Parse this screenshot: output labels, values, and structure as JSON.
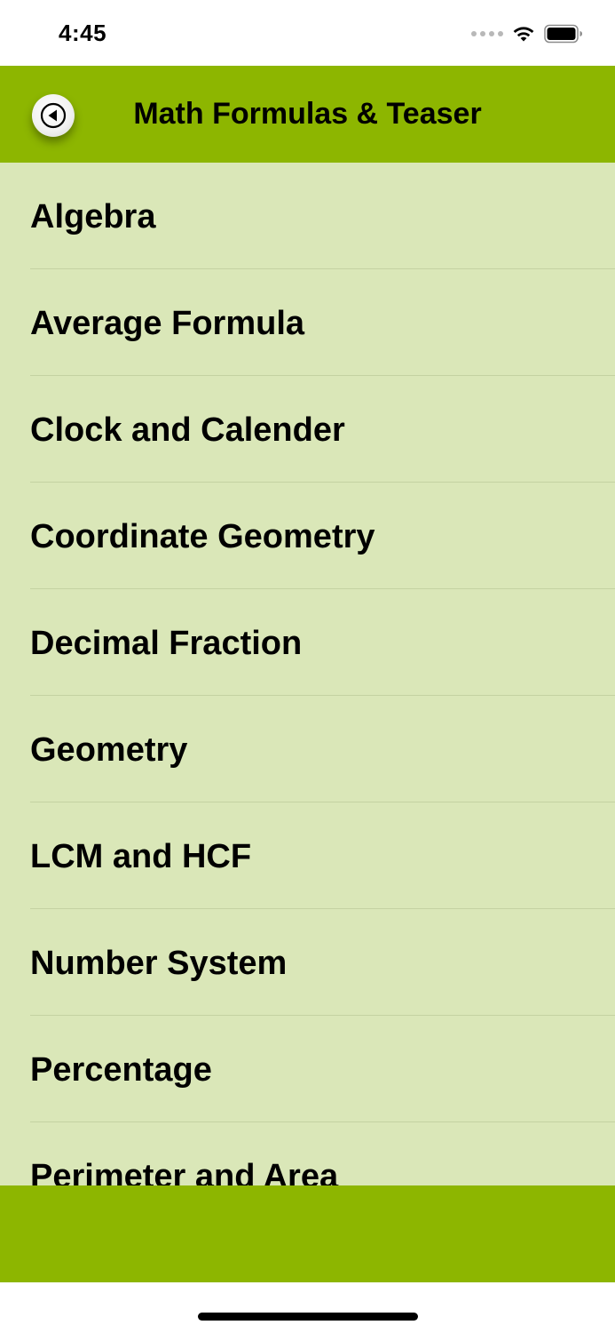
{
  "status_bar": {
    "time": "4:45",
    "icons": [
      "signal-dots-icon",
      "wifi-icon",
      "battery-icon"
    ]
  },
  "header": {
    "title": "Math Formulas & Teaser",
    "back_icon": "back-arrow-icon",
    "background_color": "#8db600"
  },
  "list": {
    "background_color": "#dae7b8",
    "items": [
      {
        "label": "Algebra"
      },
      {
        "label": "Average Formula"
      },
      {
        "label": "Clock and Calender"
      },
      {
        "label": "Coordinate Geometry"
      },
      {
        "label": "Decimal Fraction"
      },
      {
        "label": "Geometry"
      },
      {
        "label": "LCM and HCF"
      },
      {
        "label": "Number System"
      },
      {
        "label": "Percentage"
      },
      {
        "label": "Perimeter and Area"
      }
    ]
  },
  "footer": {
    "background_color": "#8db600"
  }
}
